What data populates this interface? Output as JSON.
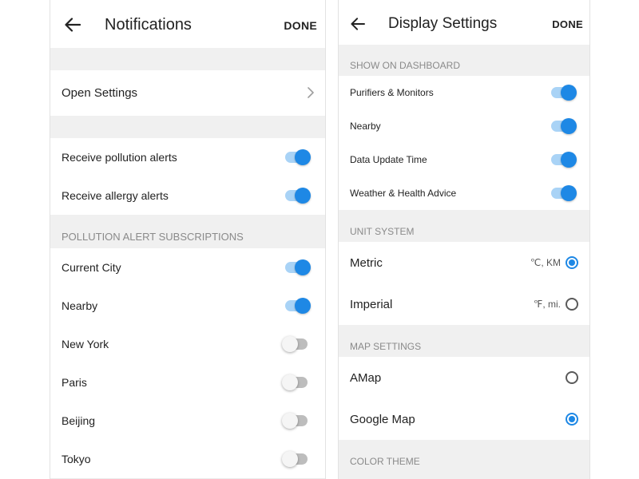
{
  "left": {
    "title": "Notifications",
    "done": "DONE",
    "open_settings": "Open Settings",
    "alerts": [
      {
        "label": "Receive pollution alerts",
        "on": true
      },
      {
        "label": "Receive allergy alerts",
        "on": true
      }
    ],
    "subscriptions_header": "POLLUTION ALERT SUBSCRIPTIONS",
    "subscriptions": [
      {
        "label": "Current City",
        "on": true
      },
      {
        "label": "Nearby",
        "on": true
      },
      {
        "label": "New York",
        "on": false
      },
      {
        "label": "Paris",
        "on": false
      },
      {
        "label": "Beijing",
        "on": false
      },
      {
        "label": "Tokyo",
        "on": false
      }
    ]
  },
  "right": {
    "title": "Display Settings",
    "done": "DONE",
    "dashboard_header": "SHOW ON DASHBOARD",
    "dashboard": [
      {
        "label": "Purifiers & Monitors",
        "on": true
      },
      {
        "label": "Nearby",
        "on": true
      },
      {
        "label": "Data Update Time",
        "on": true
      },
      {
        "label": "Weather & Health Advice",
        "on": true
      }
    ],
    "unit_header": "UNIT SYSTEM",
    "units": [
      {
        "label": "Metric",
        "unit": "℃, KM",
        "selected": true
      },
      {
        "label": "Imperial",
        "unit": "℉, mi.",
        "selected": false
      }
    ],
    "map_header": "MAP SETTINGS",
    "maps": [
      {
        "label": "AMap",
        "selected": false
      },
      {
        "label": "Google Map",
        "selected": true
      }
    ],
    "color_header": "COLOR THEME"
  },
  "colors": {
    "accent": "#1e88e5",
    "accent_light": "#a9d3f6",
    "section_bg": "#f0f0f0"
  },
  "icons": {
    "back": "arrow-left-icon",
    "chevron": "chevron-right-icon"
  }
}
